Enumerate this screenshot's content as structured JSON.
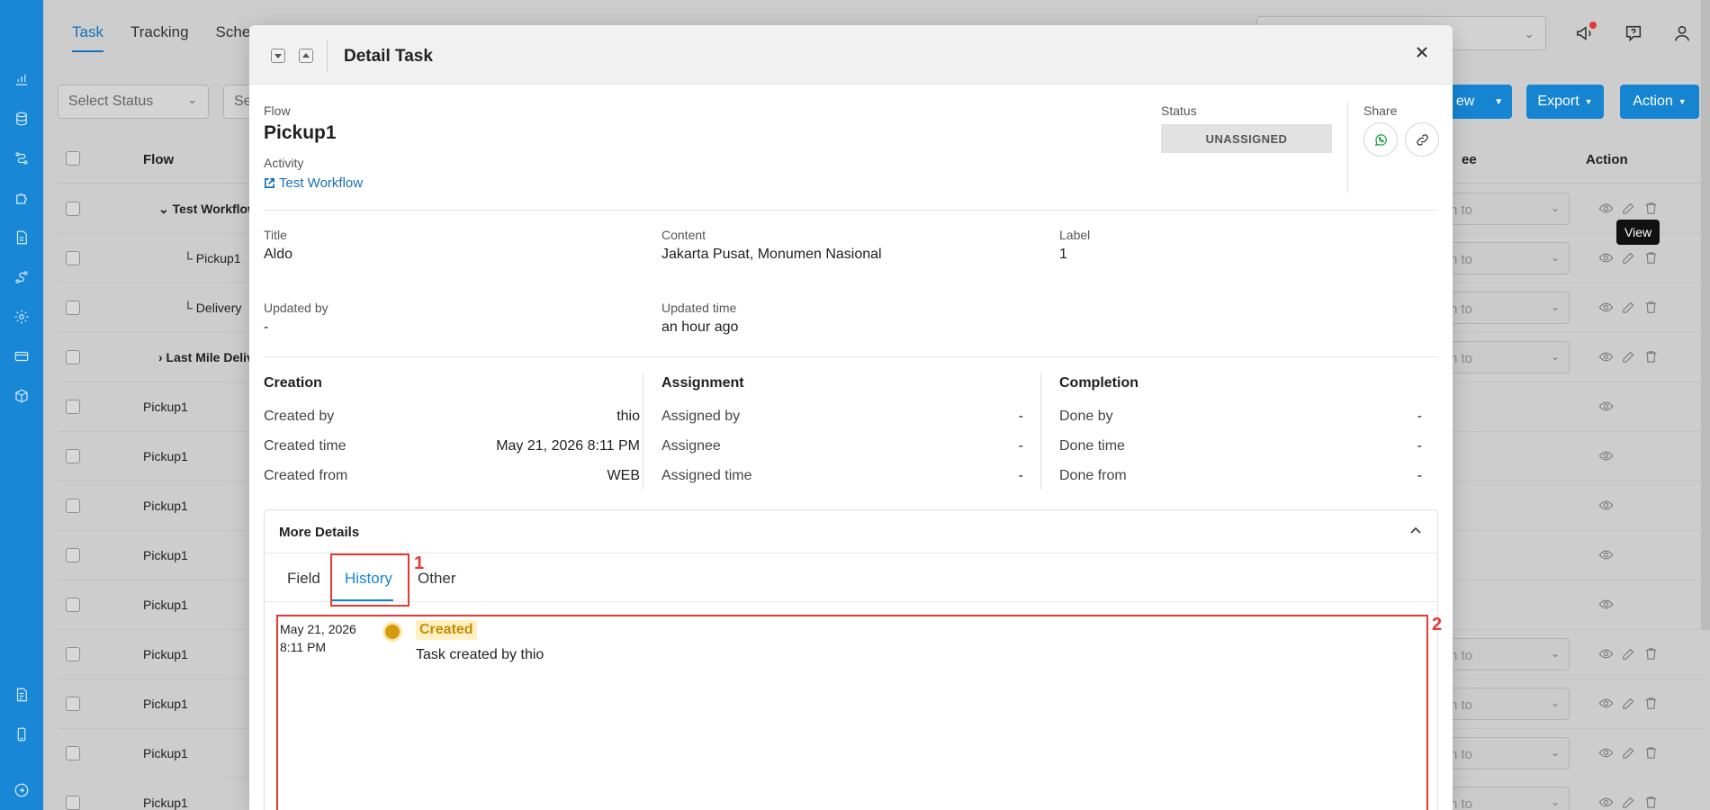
{
  "background": {
    "nav_tabs": [
      "Task",
      "Tracking",
      "Sche"
    ],
    "filters": {
      "status_placeholder": "Select Status",
      "second_placeholder": "Se"
    },
    "buttons": {
      "new": "ew",
      "export": "Export",
      "action": "Action"
    },
    "table": {
      "headers": {
        "flow": "Flow",
        "assignee": "ee",
        "action": "Action"
      },
      "rows": [
        {
          "flow": "Test Workflow",
          "assign": "n to"
        },
        {
          "flow": "Pickup1",
          "assign": "n to"
        },
        {
          "flow": "Delivery",
          "assign": "n to"
        },
        {
          "flow": "Last Mile Deliv",
          "assign": "n to"
        },
        {
          "flow": "Pickup1",
          "assign": ""
        },
        {
          "flow": "Pickup1",
          "assign": ""
        },
        {
          "flow": "Pickup1",
          "assign": ""
        },
        {
          "flow": "Pickup1",
          "assign": ""
        },
        {
          "flow": "Pickup1",
          "assign": ""
        },
        {
          "flow": "Pickup1",
          "assign": "n to"
        },
        {
          "flow": "Pickup1",
          "assign": "n to"
        },
        {
          "flow": "Pickup1",
          "assign": "n to"
        },
        {
          "flow": "Pickup1",
          "assign": "n to"
        }
      ]
    },
    "tooltip": "View"
  },
  "modal": {
    "title": "Detail Task",
    "flow_label": "Flow",
    "flow_value": "Pickup1",
    "activity_label": "Activity",
    "activity_link": "Test Workflow",
    "status_label": "Status",
    "status_value": "UNASSIGNED",
    "share_label": "Share",
    "title_label": "Title",
    "title_value": "Aldo",
    "content_label": "Content",
    "content_value": "Jakarta Pusat, Monumen Nasional",
    "label_label": "Label",
    "label_value": "1",
    "updated_by_label": "Updated by",
    "updated_by_value": "-",
    "updated_time_label": "Updated time",
    "updated_time_value": "an hour ago",
    "creation": {
      "title": "Creation",
      "rows": [
        {
          "k": "Created by",
          "v": "thio"
        },
        {
          "k": "Created time",
          "v": "May 21, 2026 8:11 PM"
        },
        {
          "k": "Created from",
          "v": "WEB"
        }
      ]
    },
    "assignment": {
      "title": "Assignment",
      "rows": [
        {
          "k": "Assigned by",
          "v": "-"
        },
        {
          "k": "Assignee",
          "v": "-"
        },
        {
          "k": "Assigned time",
          "v": "-"
        }
      ]
    },
    "completion": {
      "title": "Completion",
      "rows": [
        {
          "k": "Done by",
          "v": "-"
        },
        {
          "k": "Done time",
          "v": "-"
        },
        {
          "k": "Done from",
          "v": "-"
        }
      ]
    },
    "more_details": {
      "title": "More Details",
      "tabs": [
        "Field",
        "History",
        "Other"
      ],
      "history": {
        "date": "May 21, 2026",
        "time": "8:11 PM",
        "event": "Created",
        "description": "Task created by thio"
      }
    },
    "annotations": [
      "1",
      "2"
    ]
  },
  "colors": {
    "sidebar": "#1787d6",
    "accent": "#1585d2",
    "highlight": "#e53935",
    "history_dot": "#d69a0d"
  }
}
